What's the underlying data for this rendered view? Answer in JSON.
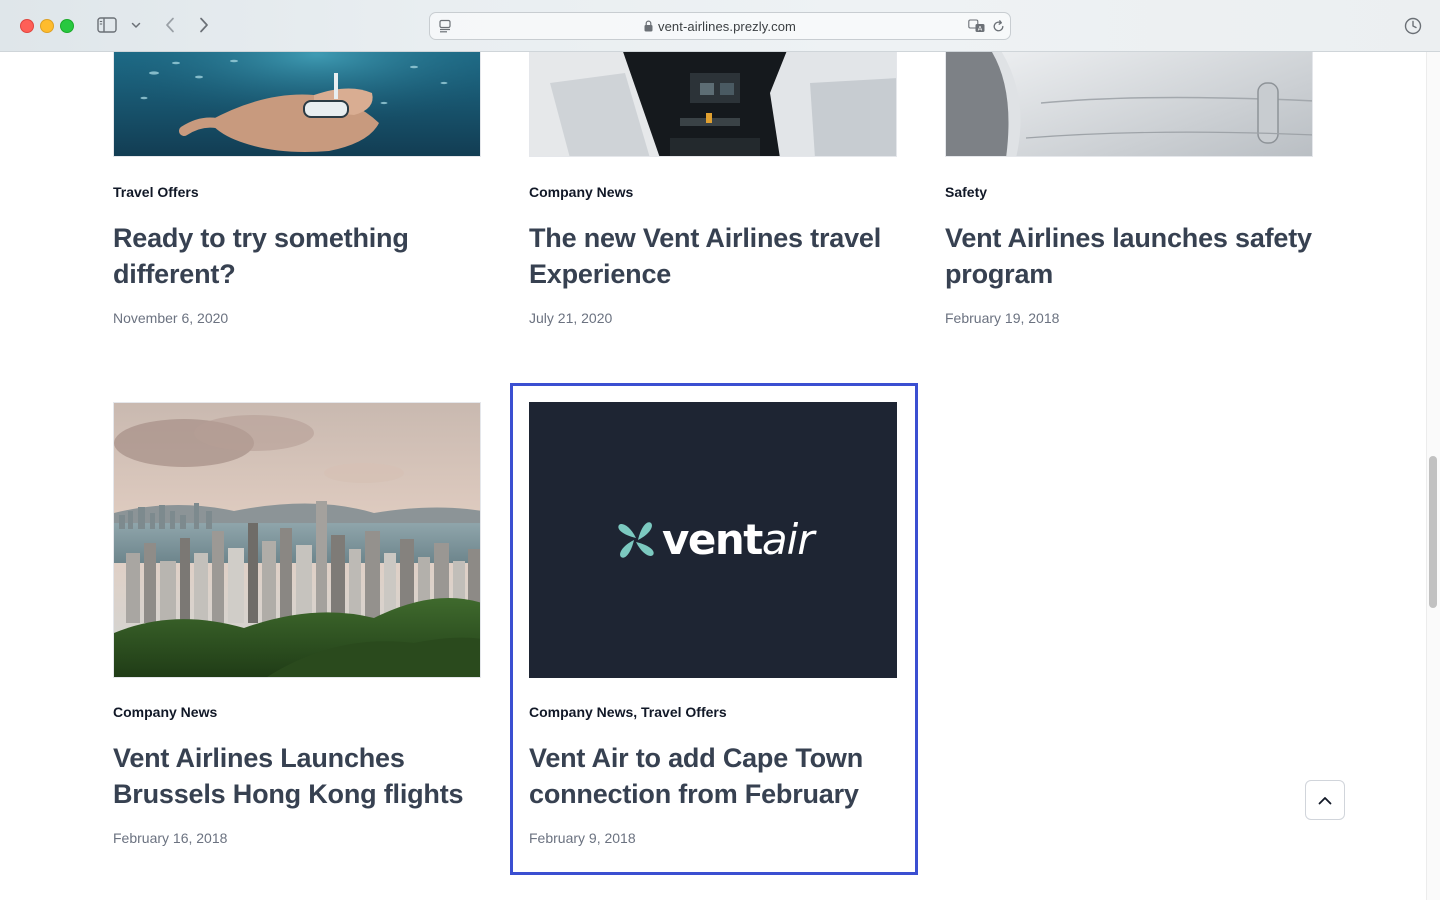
{
  "browser": {
    "url": "vent-airlines.prezly.com"
  },
  "logo": {
    "text_bold": "vent",
    "text_italic": "air",
    "background": "#1e2533",
    "accent": "#7cc9c0"
  },
  "stories": [
    {
      "categories": [
        "Travel Offers"
      ],
      "title": "Ready to try something different?",
      "date": "November 6, 2020",
      "image": "underwater-snorkeler-photo"
    },
    {
      "categories": [
        "Company News"
      ],
      "title": "The new Vent Airlines travel Experience",
      "date": "July 21, 2020",
      "image": "cockpit-pilots-photo"
    },
    {
      "categories": [
        "Safety"
      ],
      "title": "Vent Airlines launches safety program",
      "date": "February 19, 2018",
      "image": "airplane-seat-photo"
    },
    {
      "categories": [
        "Company News"
      ],
      "title": "Vent Airlines Launches Brussels Hong Kong flights",
      "date": "February 16, 2018",
      "image": "hong-kong-skyline-photo"
    },
    {
      "categories": [
        "Company News",
        "Travel Offers"
      ],
      "category_separator": ",",
      "title": "Vent Air to add Cape Town connection from February",
      "date": "February 9, 2018",
      "image": "ventair-logo"
    }
  ],
  "colors": {
    "focus_ring": "#3b4fd1",
    "title_text": "#374151",
    "category_text": "#111827",
    "date_text": "#6b7280"
  }
}
